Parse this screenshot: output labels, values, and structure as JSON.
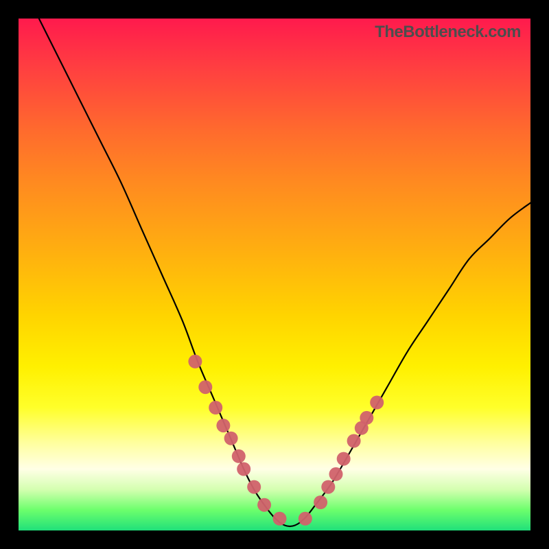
{
  "watermark": "TheBottleneck.com",
  "chart_data": {
    "type": "line",
    "title": "",
    "xlabel": "",
    "ylabel": "",
    "xlim": [
      0,
      100
    ],
    "ylim": [
      0,
      100
    ],
    "series": [
      {
        "name": "bottleneck-curve",
        "x": [
          4,
          8,
          12,
          16,
          20,
          24,
          28,
          32,
          35,
          38,
          41,
          44,
          46,
          48,
          50,
          52,
          54,
          56,
          58,
          61,
          64,
          68,
          72,
          76,
          80,
          84,
          88,
          92,
          96,
          100
        ],
        "y": [
          100,
          92,
          84,
          76,
          68,
          59,
          50,
          41,
          33,
          26,
          19,
          12,
          8,
          5,
          2.5,
          1,
          1,
          2.5,
          5,
          9,
          14,
          21,
          28,
          35,
          41,
          47,
          53,
          57,
          61,
          64
        ]
      }
    ],
    "markers": {
      "name": "highlighted-points",
      "color": "#d1626c",
      "points": [
        {
          "x": 34.5,
          "y": 33
        },
        {
          "x": 36.5,
          "y": 28
        },
        {
          "x": 38.5,
          "y": 24
        },
        {
          "x": 40,
          "y": 20.5
        },
        {
          "x": 41.5,
          "y": 18
        },
        {
          "x": 43,
          "y": 14.5
        },
        {
          "x": 44,
          "y": 12
        },
        {
          "x": 46,
          "y": 8.5
        },
        {
          "x": 48,
          "y": 5
        },
        {
          "x": 51,
          "y": 2.3
        },
        {
          "x": 56,
          "y": 2.3
        },
        {
          "x": 59,
          "y": 5.5
        },
        {
          "x": 60.5,
          "y": 8.5
        },
        {
          "x": 62,
          "y": 11
        },
        {
          "x": 63.5,
          "y": 14
        },
        {
          "x": 65.5,
          "y": 17.5
        },
        {
          "x": 67,
          "y": 20
        },
        {
          "x": 68,
          "y": 22
        },
        {
          "x": 70,
          "y": 25
        }
      ]
    }
  }
}
